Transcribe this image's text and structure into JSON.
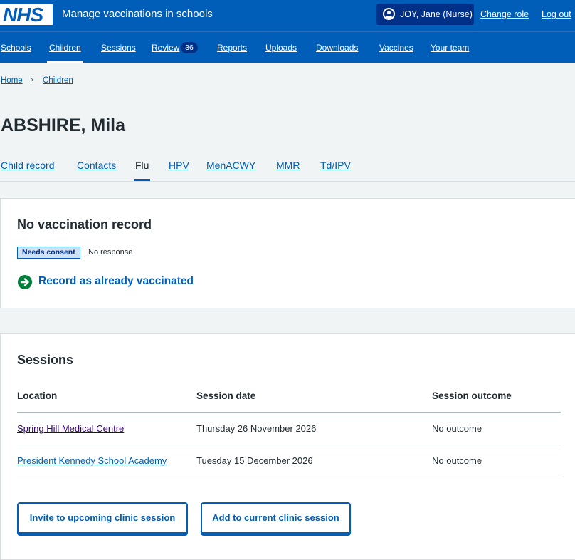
{
  "header": {
    "logo_text": "NHS",
    "service_name": "Manage vaccinations in schools",
    "user": "JOY, Jane (Nurse)",
    "change_role": "Change role",
    "log_out": "Log out",
    "user_icon": "user-circle-icon"
  },
  "nav": {
    "items": [
      "Schools",
      "Children",
      "Sessions",
      "Review",
      "Reports",
      "Uploads",
      "Downloads",
      "Vaccines",
      "Your team"
    ],
    "active": "Children",
    "review_count": "36"
  },
  "breadcrumb": {
    "home": "Home",
    "separator": "›",
    "children": "Children"
  },
  "page": {
    "title": "ABSHIRE, Mila"
  },
  "tabs": {
    "items": [
      "Child record",
      "Contacts",
      "Flu",
      "HPV",
      "MenACWY",
      "MMR",
      "Td/IPV"
    ],
    "active": "Flu"
  },
  "vaccination": {
    "heading": "No vaccination record",
    "status_tag": "Needs consent",
    "status_text": "No response",
    "action": "Record as already vaccinated",
    "action_icon": "arrow-right-circle-icon",
    "action_icon_color": "#007f3b"
  },
  "sessions": {
    "heading": "Sessions",
    "columns": [
      "Location",
      "Session date",
      "Session outcome"
    ],
    "rows": [
      {
        "location": "Spring Hill Medical Centre",
        "date": "Thursday 26 November 2026",
        "outcome": "No outcome"
      },
      {
        "location": "President Kennedy School Academy",
        "date": "Tuesday 15 December 2026",
        "outcome": "No outcome"
      }
    ],
    "buttons": {
      "invite": "Invite to upcoming clinic session",
      "add": "Add to current clinic session"
    }
  },
  "colors": {
    "brand_blue": "#005eb8",
    "dark_blue": "#003087",
    "page_bg": "#f0f4f5",
    "visited_link": "#330072"
  }
}
